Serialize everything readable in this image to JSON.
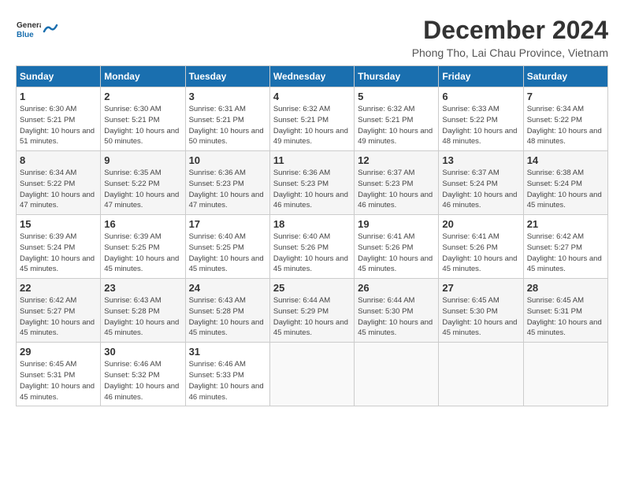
{
  "logo": {
    "text_general": "General",
    "text_blue": "Blue"
  },
  "header": {
    "title": "December 2024",
    "subtitle": "Phong Tho, Lai Chau Province, Vietnam"
  },
  "calendar": {
    "columns": [
      "Sunday",
      "Monday",
      "Tuesday",
      "Wednesday",
      "Thursday",
      "Friday",
      "Saturday"
    ],
    "weeks": [
      [
        {
          "day": "",
          "info": ""
        },
        {
          "day": "2",
          "info": "Sunrise: 6:30 AM\nSunset: 5:21 PM\nDaylight: 10 hours\nand 50 minutes."
        },
        {
          "day": "3",
          "info": "Sunrise: 6:31 AM\nSunset: 5:21 PM\nDaylight: 10 hours\nand 50 minutes."
        },
        {
          "day": "4",
          "info": "Sunrise: 6:32 AM\nSunset: 5:21 PM\nDaylight: 10 hours\nand 49 minutes."
        },
        {
          "day": "5",
          "info": "Sunrise: 6:32 AM\nSunset: 5:21 PM\nDaylight: 10 hours\nand 49 minutes."
        },
        {
          "day": "6",
          "info": "Sunrise: 6:33 AM\nSunset: 5:22 PM\nDaylight: 10 hours\nand 48 minutes."
        },
        {
          "day": "7",
          "info": "Sunrise: 6:34 AM\nSunset: 5:22 PM\nDaylight: 10 hours\nand 48 minutes."
        }
      ],
      [
        {
          "day": "8",
          "info": "Sunrise: 6:34 AM\nSunset: 5:22 PM\nDaylight: 10 hours\nand 47 minutes."
        },
        {
          "day": "9",
          "info": "Sunrise: 6:35 AM\nSunset: 5:22 PM\nDaylight: 10 hours\nand 47 minutes."
        },
        {
          "day": "10",
          "info": "Sunrise: 6:36 AM\nSunset: 5:23 PM\nDaylight: 10 hours\nand 47 minutes."
        },
        {
          "day": "11",
          "info": "Sunrise: 6:36 AM\nSunset: 5:23 PM\nDaylight: 10 hours\nand 46 minutes."
        },
        {
          "day": "12",
          "info": "Sunrise: 6:37 AM\nSunset: 5:23 PM\nDaylight: 10 hours\nand 46 minutes."
        },
        {
          "day": "13",
          "info": "Sunrise: 6:37 AM\nSunset: 5:24 PM\nDaylight: 10 hours\nand 46 minutes."
        },
        {
          "day": "14",
          "info": "Sunrise: 6:38 AM\nSunset: 5:24 PM\nDaylight: 10 hours\nand 45 minutes."
        }
      ],
      [
        {
          "day": "15",
          "info": "Sunrise: 6:39 AM\nSunset: 5:24 PM\nDaylight: 10 hours\nand 45 minutes."
        },
        {
          "day": "16",
          "info": "Sunrise: 6:39 AM\nSunset: 5:25 PM\nDaylight: 10 hours\nand 45 minutes."
        },
        {
          "day": "17",
          "info": "Sunrise: 6:40 AM\nSunset: 5:25 PM\nDaylight: 10 hours\nand 45 minutes."
        },
        {
          "day": "18",
          "info": "Sunrise: 6:40 AM\nSunset: 5:26 PM\nDaylight: 10 hours\nand 45 minutes."
        },
        {
          "day": "19",
          "info": "Sunrise: 6:41 AM\nSunset: 5:26 PM\nDaylight: 10 hours\nand 45 minutes."
        },
        {
          "day": "20",
          "info": "Sunrise: 6:41 AM\nSunset: 5:26 PM\nDaylight: 10 hours\nand 45 minutes."
        },
        {
          "day": "21",
          "info": "Sunrise: 6:42 AM\nSunset: 5:27 PM\nDaylight: 10 hours\nand 45 minutes."
        }
      ],
      [
        {
          "day": "22",
          "info": "Sunrise: 6:42 AM\nSunset: 5:27 PM\nDaylight: 10 hours\nand 45 minutes."
        },
        {
          "day": "23",
          "info": "Sunrise: 6:43 AM\nSunset: 5:28 PM\nDaylight: 10 hours\nand 45 minutes."
        },
        {
          "day": "24",
          "info": "Sunrise: 6:43 AM\nSunset: 5:28 PM\nDaylight: 10 hours\nand 45 minutes."
        },
        {
          "day": "25",
          "info": "Sunrise: 6:44 AM\nSunset: 5:29 PM\nDaylight: 10 hours\nand 45 minutes."
        },
        {
          "day": "26",
          "info": "Sunrise: 6:44 AM\nSunset: 5:30 PM\nDaylight: 10 hours\nand 45 minutes."
        },
        {
          "day": "27",
          "info": "Sunrise: 6:45 AM\nSunset: 5:30 PM\nDaylight: 10 hours\nand 45 minutes."
        },
        {
          "day": "28",
          "info": "Sunrise: 6:45 AM\nSunset: 5:31 PM\nDaylight: 10 hours\nand 45 minutes."
        }
      ],
      [
        {
          "day": "29",
          "info": "Sunrise: 6:45 AM\nSunset: 5:31 PM\nDaylight: 10 hours\nand 45 minutes."
        },
        {
          "day": "30",
          "info": "Sunrise: 6:46 AM\nSunset: 5:32 PM\nDaylight: 10 hours\nand 46 minutes."
        },
        {
          "day": "31",
          "info": "Sunrise: 6:46 AM\nSunset: 5:33 PM\nDaylight: 10 hours\nand 46 minutes."
        },
        {
          "day": "",
          "info": ""
        },
        {
          "day": "",
          "info": ""
        },
        {
          "day": "",
          "info": ""
        },
        {
          "day": "",
          "info": ""
        }
      ]
    ],
    "week0_day1": {
      "day": "1",
      "info": "Sunrise: 6:30 AM\nSunset: 5:21 PM\nDaylight: 10 hours\nand 51 minutes."
    }
  }
}
